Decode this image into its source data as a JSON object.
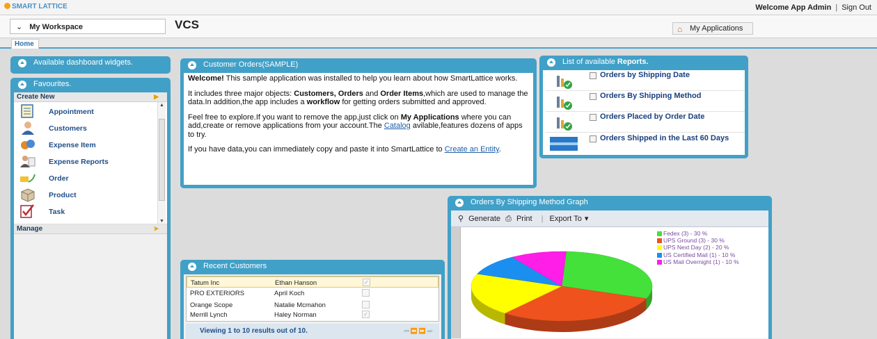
{
  "app": {
    "logo": "SMART LATTICE",
    "welcome": "Welcome App Admin",
    "sign_out": "Sign Out"
  },
  "workspace": {
    "label": "My Workspace",
    "title": "VCS",
    "my_apps": "My Applications"
  },
  "tabs": [
    {
      "label": "Home"
    }
  ],
  "widgets_panel": {
    "title": "Available dashboard widgets."
  },
  "favourites": {
    "title": "Favourites.",
    "create_new": "Create New",
    "manage": "Manage",
    "items": [
      {
        "label": "Appointment",
        "icon": "calendar-icon"
      },
      {
        "label": "Customers",
        "icon": "person-icon"
      },
      {
        "label": "Expense Item",
        "icon": "coins-icon"
      },
      {
        "label": "Expense Reports",
        "icon": "report-person-icon"
      },
      {
        "label": "Order",
        "icon": "order-truck-icon"
      },
      {
        "label": "Product",
        "icon": "box-icon"
      },
      {
        "label": "Task",
        "icon": "task-check-icon"
      }
    ]
  },
  "orders_panel": {
    "title": "Customer Orders(SAMPLE)",
    "p1_bold": "Welcome!",
    "p1_text": " This sample application was installed to help you learn about how SmartLattice works.",
    "p2_a": "It includes three major objects: ",
    "p2_b1": "Customers, Orders",
    "p2_c": " and ",
    "p2_b2": "Order Items",
    "p2_d": ",which are used to manage the data.In addition,the app includes a ",
    "p2_b3": "workflow",
    "p2_e": " for getting orders submitted and approved.",
    "p3_a": "Feel free to explore.If you want to remove the app,just click on ",
    "p3_b": "My Applications",
    "p3_c": " where you can add,create or remove applications from your account.The ",
    "p3_link": "Catalog",
    "p3_d": " avilable,features dozens of apps to try.",
    "p4_a": "If you have data,you can immediately copy and paste it into SmartLattice to ",
    "p4_link": "Create an Entity",
    "p4_b": "."
  },
  "reports_panel": {
    "title_a": "List of available ",
    "title_b": "Reports.",
    "items": [
      {
        "label": "Orders by Shipping Date"
      },
      {
        "label": "Orders By Shipping Method"
      },
      {
        "label": "Orders Placed by Order Date"
      },
      {
        "label": "Orders Shipped in the Last 60 Days"
      }
    ]
  },
  "graph_panel": {
    "title": "Orders By Shipping Method Graph",
    "toolbar": {
      "generate": "Generate",
      "print": "Print",
      "export": "Export To"
    },
    "legend": [
      {
        "label": "Fedex (3) - 30 %",
        "color": "#44e13a"
      },
      {
        "label": "UPS Ground (3) - 30 %",
        "color": "#f0521e"
      },
      {
        "label": "UPS Next Day (2) - 20 %",
        "color": "#ffff00"
      },
      {
        "label": "US Certified Mail (1) - 10 %",
        "color": "#1b8ff0"
      },
      {
        "label": "US Mail Overnight (1) - 10 %",
        "color": "#ff1ee8"
      }
    ]
  },
  "chart_data": {
    "type": "pie",
    "categories": [
      "Fedex",
      "UPS Ground",
      "UPS Next Day",
      "US Certified Mail",
      "US Mail Overnight"
    ],
    "values": [
      3,
      3,
      2,
      1,
      1
    ],
    "percent": [
      30,
      30,
      20,
      10,
      10
    ]
  },
  "recent_panel": {
    "title": "Recent Customers",
    "rows": [
      {
        "company": "Tatum Inc",
        "contact": "Ethan Hanson",
        "checked": true
      },
      {
        "company": "PRO EXTERIORS",
        "contact": "April Koch",
        "checked": false
      },
      {
        "company": "Orange Scope",
        "contact": "Natalie Mcmahon",
        "checked": false
      },
      {
        "company": "Merrill Lynch",
        "contact": "Haley Norman",
        "checked": true
      }
    ],
    "footer": "Viewing 1 to 10 results out of 10."
  }
}
